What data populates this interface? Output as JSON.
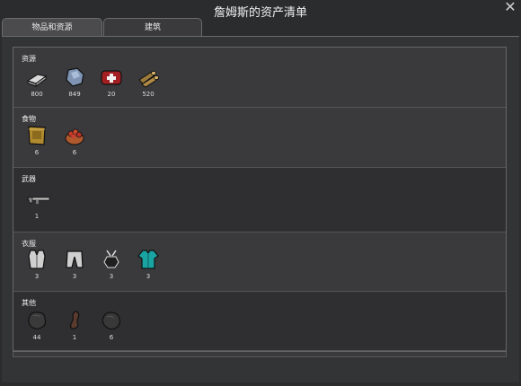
{
  "window": {
    "title": "詹姆斯的资产清单",
    "close_icon": "close-icon"
  },
  "tabs": [
    {
      "label": "物品和资源",
      "active": true
    },
    {
      "label": "建筑",
      "active": false
    }
  ],
  "sections": [
    {
      "title": "资源",
      "items": [
        {
          "icon": "steel-ingot-icon",
          "count": "800"
        },
        {
          "icon": "stone-chunk-icon",
          "count": "849"
        },
        {
          "icon": "medkit-icon",
          "count": "20"
        },
        {
          "icon": "wood-logs-icon",
          "count": "520"
        }
      ]
    },
    {
      "title": "食物",
      "items": [
        {
          "icon": "packaged-survival-meal-icon",
          "count": "6"
        },
        {
          "icon": "berries-icon",
          "count": "6"
        }
      ]
    },
    {
      "title": "武器",
      "items": [
        {
          "icon": "rifle-icon",
          "count": "1"
        }
      ]
    },
    {
      "title": "衣服",
      "items": [
        {
          "icon": "vest-icon",
          "count": "3"
        },
        {
          "icon": "pants-icon",
          "count": "3"
        },
        {
          "icon": "tribal-garment-icon",
          "count": "3"
        },
        {
          "icon": "shirt-icon",
          "count": "3"
        }
      ]
    },
    {
      "title": "其他",
      "items": [
        {
          "icon": "rock-chunk-icon",
          "count": "44"
        },
        {
          "icon": "leather-scrap-icon",
          "count": "1"
        },
        {
          "icon": "rock-chunk-icon",
          "count": "6"
        }
      ]
    }
  ]
}
